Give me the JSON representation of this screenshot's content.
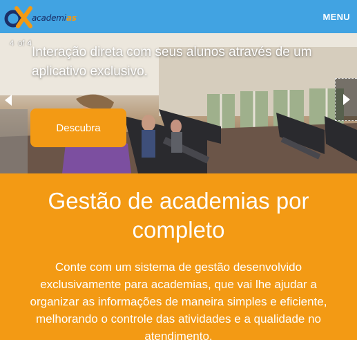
{
  "colors": {
    "header_bg": "#41a3e2",
    "accent_orange": "#f39a14",
    "logo_navy": "#1b2f67",
    "text_light": "#ffffff"
  },
  "header": {
    "logo_text_main": "academi",
    "logo_text_accent": "as",
    "menu_label": "MENU"
  },
  "slider": {
    "counter_current": "4",
    "counter_sep": "of",
    "counter_total": "4",
    "caption": "Interação direta com seus alunos através de um aplicativo exclusivo.",
    "cta_label": "Descubra",
    "prev_icon": "chevron-left-icon",
    "next_icon": "chevron-right-icon"
  },
  "feature": {
    "title": "Gestão de academias por completo",
    "description": "Conte com um sistema de gestão desenvolvido exclusivamente para academias, que vai lhe ajudar a organizar as informações de maneira simples e eficiente, melhorando o controle das atividades e a qualidade no atendimento."
  }
}
